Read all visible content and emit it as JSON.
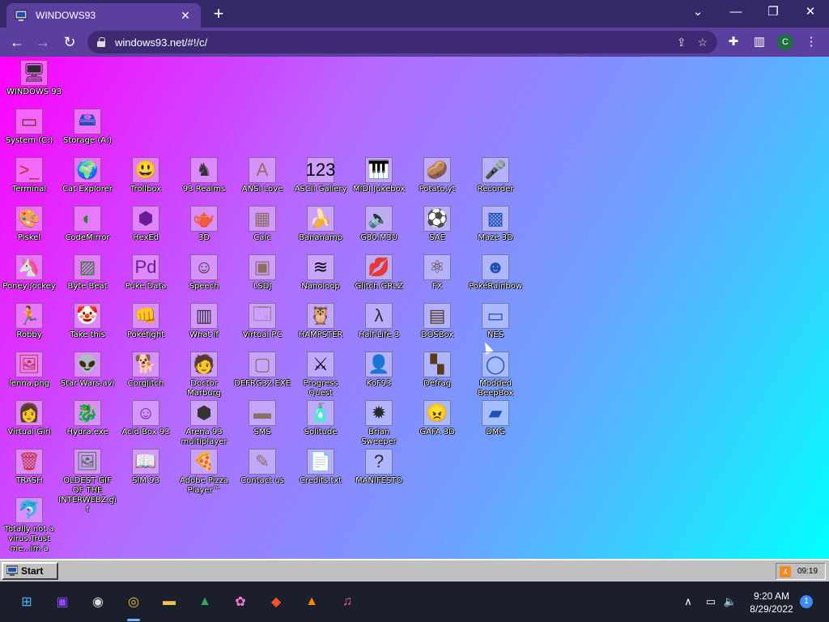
{
  "browser": {
    "tab_title": "WINDOWS93",
    "url": "windows93.net/#!/c/",
    "profile_initial": "C",
    "tab_close": "✕",
    "new_tab": "+",
    "nav": {
      "back": "←",
      "forward": "→",
      "reload": "↻"
    },
    "window_controls": {
      "list": "⌄",
      "minimize": "—",
      "restore": "❐",
      "close": "✕"
    },
    "toolbar_icons": {
      "share": "⇪",
      "bookmark": "☆",
      "extensions": "✚",
      "side_panel": "▥",
      "menu": "⋮"
    }
  },
  "desktop": {
    "icons": [
      {
        "label": "WINDOWS 93",
        "icon": "computer-icon",
        "glyph": "🖥"
      },
      {
        "label": "System (C:)",
        "icon": "drive-icon",
        "glyph": "▭"
      },
      {
        "label": "Storage (A:)",
        "icon": "floppy-drive-icon",
        "glyph": "🖴"
      },
      {
        "label": "Terminal",
        "icon": "terminal-icon",
        "glyph": ">_"
      },
      {
        "label": "Cat Explorer",
        "icon": "globe-cat-icon",
        "glyph": "🌍"
      },
      {
        "label": "Trollbox",
        "icon": "trollface-icon",
        "glyph": "😃"
      },
      {
        "label": "93 Realms",
        "icon": "knight-icon",
        "glyph": "♞"
      },
      {
        "label": "ANSI Love",
        "icon": "letter-a-icon",
        "glyph": "A"
      },
      {
        "label": "ASCII Gallery",
        "icon": "numbers-icon",
        "glyph": "123"
      },
      {
        "label": "MIDI Jukebox",
        "icon": "keyboard-icon",
        "glyph": "🎹"
      },
      {
        "label": "Potato.yt",
        "icon": "potato-icon",
        "glyph": "🥔"
      },
      {
        "label": "Recorder",
        "icon": "microphone-icon",
        "glyph": "🎤"
      },
      {
        "label": "Piskel",
        "icon": "palette-icon",
        "glyph": "🎨"
      },
      {
        "label": "CodeMirror",
        "icon": "codemirror-icon",
        "glyph": "◐"
      },
      {
        "label": "HexEd",
        "icon": "cube-icon",
        "glyph": "⬢"
      },
      {
        "label": "3D",
        "icon": "teapot-icon",
        "glyph": "🫖"
      },
      {
        "label": "Calc",
        "icon": "calculator-icon",
        "glyph": "▦"
      },
      {
        "label": "Bananamp",
        "icon": "banana-icon",
        "glyph": "🍌"
      },
      {
        "label": "G80.M3U",
        "icon": "speaker-file-icon",
        "glyph": "🔊"
      },
      {
        "label": "SAE",
        "icon": "amiga-ball-icon",
        "glyph": "⚽"
      },
      {
        "label": "Maze 3D",
        "icon": "maze-icon",
        "glyph": "▩"
      },
      {
        "label": "Poney Jockey",
        "icon": "pony-icon",
        "glyph": "🦄"
      },
      {
        "label": "Byte Beat",
        "icon": "bytebeat-icon",
        "glyph": "▨"
      },
      {
        "label": "Puke Data",
        "icon": "puke-data-icon",
        "glyph": "Pd"
      },
      {
        "label": "Speech",
        "icon": "face-icon",
        "glyph": "☺"
      },
      {
        "label": "LSDJ",
        "icon": "gameboy-icon",
        "glyph": "▣"
      },
      {
        "label": "Nanoloop",
        "icon": "wave-icon",
        "glyph": "≋"
      },
      {
        "label": "Glitch GRLZ",
        "icon": "lips-icon",
        "glyph": "💋"
      },
      {
        "label": "FX",
        "icon": "atom-icon",
        "glyph": "⚛"
      },
      {
        "label": "PokéRainbow",
        "icon": "pokemon-icon",
        "glyph": "☻"
      },
      {
        "label": "Robby",
        "icon": "stickman-icon",
        "glyph": "🏃"
      },
      {
        "label": "Take this",
        "icon": "clown-icon",
        "glyph": "🤡"
      },
      {
        "label": "Pokéfight",
        "icon": "pokefight-icon",
        "glyph": "👊"
      },
      {
        "label": "What If",
        "icon": "whatif-icon",
        "glyph": "▥"
      },
      {
        "label": "Virtual PC",
        "icon": "virtual-pc-icon",
        "glyph": "🗔"
      },
      {
        "label": "HAMPSTER",
        "icon": "owl-icon",
        "glyph": "🦉"
      },
      {
        "label": "Half-Life 3",
        "icon": "lambda-icon",
        "glyph": "λ"
      },
      {
        "label": "DOSBox",
        "icon": "dosbox-icon",
        "glyph": "▤"
      },
      {
        "label": "NES",
        "icon": "nes-icon",
        "glyph": "▭"
      },
      {
        "label": "lenna.png",
        "icon": "image-file-icon",
        "glyph": "🖼"
      },
      {
        "label": "Star Wars.avi",
        "icon": "yoda-icon",
        "glyph": "👽"
      },
      {
        "label": "Corglitch",
        "icon": "corgi-icon",
        "glyph": "🐕"
      },
      {
        "label": "Doctor Marburg",
        "icon": "doctor-icon",
        "glyph": "🧑"
      },
      {
        "label": "DEFRG32.EXE",
        "icon": "defrag-monitor-icon",
        "glyph": "▢"
      },
      {
        "label": "Progress Quest",
        "icon": "swords-icon",
        "glyph": "⚔"
      },
      {
        "label": "KoF93",
        "icon": "fighter-icon",
        "glyph": "👤"
      },
      {
        "label": "Defrag",
        "icon": "defrag-icon",
        "glyph": "▚"
      },
      {
        "label": "Modded BeepBox",
        "icon": "beepbox-icon",
        "glyph": "◯"
      },
      {
        "label": "Virtual Girl",
        "icon": "virtual-girl-icon",
        "glyph": "👩"
      },
      {
        "label": "Hydra.exe",
        "icon": "hydra-icon",
        "glyph": "🐉"
      },
      {
        "label": "Acid Box 93",
        "icon": "smiley-icon",
        "glyph": "☺"
      },
      {
        "label": "Arena 93 multiplayer",
        "icon": "arena-cube-icon",
        "glyph": "⬢"
      },
      {
        "label": "SMS",
        "icon": "console-icon",
        "glyph": "▬"
      },
      {
        "label": "Solitude",
        "icon": "bottle-icon",
        "glyph": "🧴"
      },
      {
        "label": "Brian Sweeper",
        "icon": "mine-icon",
        "glyph": "✹"
      },
      {
        "label": "GAFA 3D",
        "icon": "doomguy-icon",
        "glyph": "😠"
      },
      {
        "label": "DMG",
        "icon": "dmg-icon",
        "glyph": "▰"
      },
      {
        "label": "TRASH",
        "icon": "trash-icon",
        "glyph": "🗑"
      },
      {
        "label": "OLDEST GIF OF THE INTERWEBZ.gif",
        "icon": "gif-file-icon",
        "glyph": "🖼"
      },
      {
        "label": "SIM 93",
        "icon": "book-icon",
        "glyph": "📖"
      },
      {
        "label": "Adobe Pizza Player™",
        "icon": "pizza-icon",
        "glyph": "🍕"
      },
      {
        "label": "Contact us",
        "icon": "contact-icon",
        "glyph": "✎"
      },
      {
        "label": "Credits.txt",
        "icon": "text-file-icon",
        "glyph": "📄"
      },
      {
        "label": "MANIFESTO",
        "icon": "question-mark-icon",
        "glyph": "?"
      },
      {
        "label": "Totally not a virus.Trust me...im a",
        "icon": "dolphin-icon",
        "glyph": "🐬"
      }
    ]
  },
  "w93_taskbar": {
    "start_label": "Start",
    "clock": "09:19",
    "rss_glyph": "ʎ"
  },
  "win_taskbar": {
    "time": "9:20 AM",
    "date": "8/29/2022",
    "notifications": "1",
    "apps": [
      {
        "icon": "windows-start-icon",
        "glyph": "⊞",
        "color": "#4fb3ff"
      },
      {
        "icon": "twitch-icon",
        "glyph": "▣",
        "color": "#9146ff"
      },
      {
        "icon": "obs-icon",
        "glyph": "◉",
        "color": "#dddddd"
      },
      {
        "icon": "chrome-icon",
        "glyph": "◎",
        "color": "#f1c232"
      },
      {
        "icon": "file-explorer-icon",
        "glyph": "▬",
        "color": "#f2c24f"
      },
      {
        "icon": "google-drive-icon",
        "glyph": "▲",
        "color": "#34a853"
      },
      {
        "icon": "photos-icon",
        "glyph": "✿",
        "color": "#ff7ad9"
      },
      {
        "icon": "brave-icon",
        "glyph": "◆",
        "color": "#fb542b"
      },
      {
        "icon": "vlc-icon",
        "glyph": "▲",
        "color": "#ff8800"
      },
      {
        "icon": "itunes-icon",
        "glyph": "♫",
        "color": "#ff5fa2"
      }
    ],
    "tray": {
      "chevron": "∧",
      "network": "▭",
      "volume": "🔈"
    }
  }
}
